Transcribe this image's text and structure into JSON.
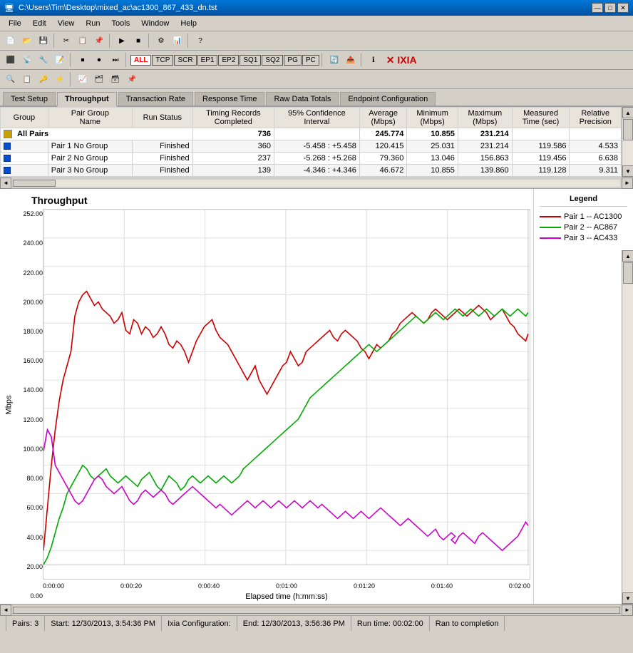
{
  "window": {
    "title": "C:\\Users\\Tim\\Desktop\\mixed_ac\\ac1300_867_433_dn.tst",
    "min_btn": "—",
    "max_btn": "□",
    "close_btn": "✕"
  },
  "menu": {
    "items": [
      "File",
      "Edit",
      "View",
      "Run",
      "Tools",
      "Window",
      "Help"
    ]
  },
  "toolbar1": {
    "all_label": "ALL",
    "tags": [
      "TCP",
      "SCR",
      "EP1",
      "EP2",
      "SQ1",
      "SQ2",
      "PG",
      "PC"
    ]
  },
  "tabs": {
    "items": [
      "Test Setup",
      "Throughput",
      "Transaction Rate",
      "Response Time",
      "Raw Data Totals",
      "Endpoint Configuration"
    ],
    "active": 1
  },
  "table": {
    "headers": {
      "group": "Group",
      "pair_group_name": "Pair Group Name",
      "run_status": "Run Status",
      "timing_records_completed": "Timing Records Completed",
      "confidence_interval": "95% Confidence Interval",
      "average_mbps": "Average (Mbps)",
      "minimum_mbps": "Minimum (Mbps)",
      "maximum_mbps": "Maximum (Mbps)",
      "measured_time": "Measured Time (sec)",
      "relative_precision": "Relative Precision"
    },
    "summary": {
      "name": "All Pairs",
      "records": "736",
      "average": "245.774",
      "minimum": "10.855",
      "maximum": "231.214"
    },
    "rows": [
      {
        "indent": "Pair 1",
        "group": "No Group",
        "status": "Finished",
        "records": "360",
        "confidence": "-5.458 : +5.458",
        "average": "120.415",
        "minimum": "25.031",
        "maximum": "231.214",
        "measured": "119.586",
        "precision": "4.533"
      },
      {
        "indent": "Pair 2",
        "group": "No Group",
        "status": "Finished",
        "records": "237",
        "confidence": "-5.268 : +5.268",
        "average": "79.360",
        "minimum": "13.046",
        "maximum": "156.863",
        "measured": "119.456",
        "precision": "6.638"
      },
      {
        "indent": "Pair 3",
        "group": "No Group",
        "status": "Finished",
        "records": "139",
        "confidence": "-4.346 : +4.346",
        "average": "46.672",
        "minimum": "10.855",
        "maximum": "139.860",
        "measured": "119.128",
        "precision": "9.311"
      }
    ]
  },
  "chart": {
    "title": "Throughput",
    "y_label": "Mbps",
    "x_label": "Elapsed time (h:mm:ss)",
    "y_ticks": [
      "252.00",
      "240.00",
      "220.00",
      "200.00",
      "180.00",
      "160.00",
      "140.00",
      "120.00",
      "100.00",
      "80.00",
      "60.00",
      "40.00",
      "20.00",
      "0.00"
    ],
    "x_ticks": [
      "0:00:00",
      "0:00:20",
      "0:00:40",
      "0:01:00",
      "0:01:20",
      "0:01:40",
      "0:02:00"
    ]
  },
  "legend": {
    "title": "Legend",
    "items": [
      {
        "label": "Pair 1 -- AC1300",
        "color": "#cc0000"
      },
      {
        "label": "Pair 2 -- AC867",
        "color": "#00aa00"
      },
      {
        "label": "Pair 3 -- AC433",
        "color": "#cc00cc"
      }
    ]
  },
  "status_bar": {
    "pairs": "Pairs: 3",
    "start": "Start: 12/30/2013, 3:54:36 PM",
    "ixia_config": "Ixia Configuration:",
    "end": "End: 12/30/2013, 3:56:36 PM",
    "run_time": "Run time: 00:02:00",
    "completion": "Ran to completion"
  }
}
